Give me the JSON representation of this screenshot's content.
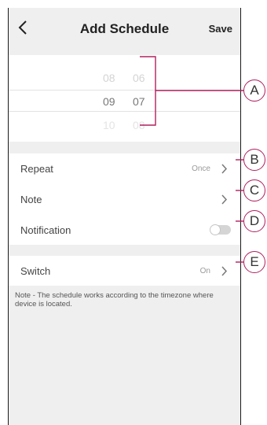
{
  "header": {
    "title": "Add Schedule",
    "save_label": "Save"
  },
  "time_picker": {
    "rows": [
      {
        "hour": "08",
        "minute": "06"
      },
      {
        "hour": "09",
        "minute": "07"
      },
      {
        "hour": "10",
        "minute": "08"
      }
    ],
    "selected_index": 1
  },
  "settings": {
    "repeat": {
      "label": "Repeat",
      "value": "Once"
    },
    "note": {
      "label": "Note"
    },
    "notification": {
      "label": "Notification",
      "enabled": false
    },
    "switch": {
      "label": "Switch",
      "value": "On"
    }
  },
  "footer_note": "Note - The schedule works according to the timezone where device is located.",
  "callouts": [
    "A",
    "B",
    "C",
    "D",
    "E"
  ],
  "colors": {
    "callout_accent": "#b0205e",
    "background": "#efefef"
  }
}
